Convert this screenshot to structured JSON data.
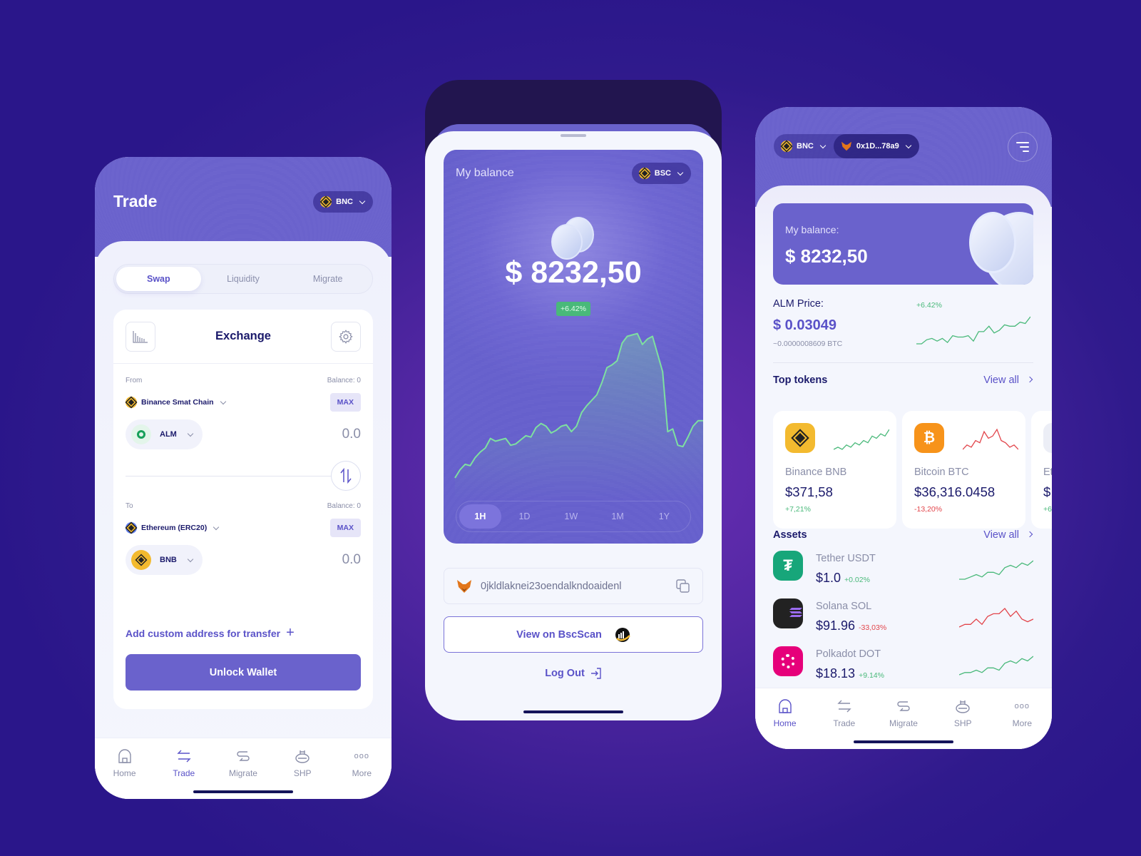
{
  "colors": {
    "accent": "#6a62cc",
    "positive": "#49b97a",
    "negative": "#e2454b",
    "chart_line": "#7ee0a0",
    "bnb": "#f3ba2f",
    "btc": "#f7931a",
    "usdt": "#17a67a",
    "sol": "#222222",
    "dot": "#e6007a"
  },
  "trade_screen": {
    "title": "Trade",
    "network_pill": {
      "icon": "binance-coin-icon",
      "label": "BNC"
    },
    "tabs": [
      {
        "label": "Swap",
        "active": true
      },
      {
        "label": "Liquidity",
        "active": false
      },
      {
        "label": "Migrate",
        "active": false
      }
    ],
    "exchange": {
      "title": "Exchange",
      "from": {
        "label": "From",
        "balance": "Balance: 0",
        "chain": "Binance Smat Chain",
        "max": "MAX",
        "token": "ALM",
        "amount": "0.0"
      },
      "to": {
        "label": "To",
        "balance": "Balance: 0",
        "chain": "Ethereum (ERC20)",
        "max": "MAX",
        "token": "BNB",
        "amount": "0.0"
      },
      "add_address": "Add custom address for transfer",
      "unlock": "Unlock Wallet"
    }
  },
  "bottom_nav": [
    {
      "label": "Home",
      "icon": "home-icon"
    },
    {
      "label": "Trade",
      "icon": "swap-arrows-icon"
    },
    {
      "label": "Migrate",
      "icon": "migrate-icon"
    },
    {
      "label": "SHP",
      "icon": "ship-icon"
    },
    {
      "label": "More",
      "icon": "more-dots-icon"
    }
  ],
  "wallet_screen": {
    "balance_label": "My balance",
    "network_pill": {
      "icon": "binance-coin-icon",
      "label": "BSC"
    },
    "balance": "$ 8232,50",
    "change": "+6.42%",
    "periods": [
      {
        "label": "1H",
        "active": true
      },
      {
        "label": "1D"
      },
      {
        "label": "1W"
      },
      {
        "label": "1M"
      },
      {
        "label": "1Y"
      }
    ],
    "address": "0jkldlaknei23oendalkndoaidenl",
    "view_on": "View on BscScan",
    "logout": "Log Out"
  },
  "chart_data": {
    "type": "area",
    "title": "",
    "xlabel": "",
    "ylabel": "",
    "x": [
      0,
      1,
      2,
      3,
      4,
      5,
      6,
      7,
      8,
      9,
      10,
      11,
      12,
      13,
      14,
      15,
      16,
      17,
      18,
      19,
      20,
      21,
      22,
      23,
      24,
      25,
      26,
      27,
      28,
      29,
      30,
      31,
      32,
      33,
      34,
      35,
      36,
      37,
      38,
      39,
      40,
      41,
      42,
      43,
      44,
      45,
      46,
      47,
      48,
      49
    ],
    "values": [
      0,
      6,
      10,
      9,
      15,
      19,
      22,
      29,
      27,
      28,
      29,
      24,
      25,
      28,
      31,
      30,
      37,
      40,
      38,
      33,
      35,
      38,
      39,
      34,
      38,
      48,
      53,
      57,
      61,
      70,
      81,
      83,
      86,
      99,
      104,
      105,
      106,
      98,
      102,
      104,
      91,
      78,
      34,
      36,
      24,
      23,
      30,
      38,
      42,
      42
    ],
    "ylim": [
      0,
      110
    ]
  },
  "home_screen": {
    "network_pill": {
      "icon": "binance-coin-icon",
      "label": "BNC"
    },
    "wallet_pill": {
      "icon": "metamask-fox-icon",
      "label": "0x1D...78a9"
    },
    "balance_label": "My balance:",
    "balance": "$ 8232,50",
    "alm": {
      "label": "ALM Price:",
      "value": "$ 0.03049",
      "btc": "~0.0000008609 BTC",
      "change": "+6.42%",
      "spark": [
        0,
        0,
        3,
        4,
        2,
        4,
        1,
        6,
        5,
        5,
        6,
        2,
        9,
        9,
        13,
        8,
        10,
        14,
        13,
        13,
        16,
        15,
        20
      ]
    },
    "top_tokens": {
      "title": "Top tokens",
      "view_all": "View all",
      "items": [
        {
          "name": "Binance BNB",
          "price": "$371,58",
          "change": "+7,21%",
          "trend": "pos",
          "spark": [
            2,
            3,
            2,
            4,
            3,
            5,
            4,
            6,
            5,
            8,
            7,
            9,
            8,
            11
          ]
        },
        {
          "name": "Bitcoin BTC",
          "price": "$36,316.0458",
          "change": "-13,20%",
          "trend": "neg",
          "spark": [
            1,
            3,
            2,
            5,
            4,
            9,
            6,
            7,
            10,
            5,
            4,
            2,
            3,
            1
          ]
        },
        {
          "name": "Et",
          "price": "$",
          "change": "+6",
          "trend": "pos",
          "spark": []
        }
      ]
    },
    "assets": {
      "title": "Assets",
      "view_all": "View all",
      "items": [
        {
          "name": "Tether USDT",
          "price": "$1.0",
          "change": "+0.02%",
          "trend": "pos",
          "spark": [
            1,
            1,
            2,
            3,
            2,
            4,
            4,
            3,
            6,
            7,
            6,
            8,
            7,
            9
          ]
        },
        {
          "name": "Solana SOL",
          "price": "$91.96",
          "change": "-33,03%",
          "trend": "neg",
          "spark": [
            1,
            2,
            2,
            4,
            2,
            5,
            6,
            6,
            8,
            5,
            7,
            4,
            3,
            4
          ]
        },
        {
          "name": "Polkadot DOT",
          "price": "$18.13",
          "change": "+9.14%",
          "trend": "pos",
          "spark": [
            1,
            2,
            2,
            3,
            2,
            4,
            4,
            3,
            6,
            7,
            6,
            8,
            7,
            9
          ]
        }
      ]
    }
  }
}
